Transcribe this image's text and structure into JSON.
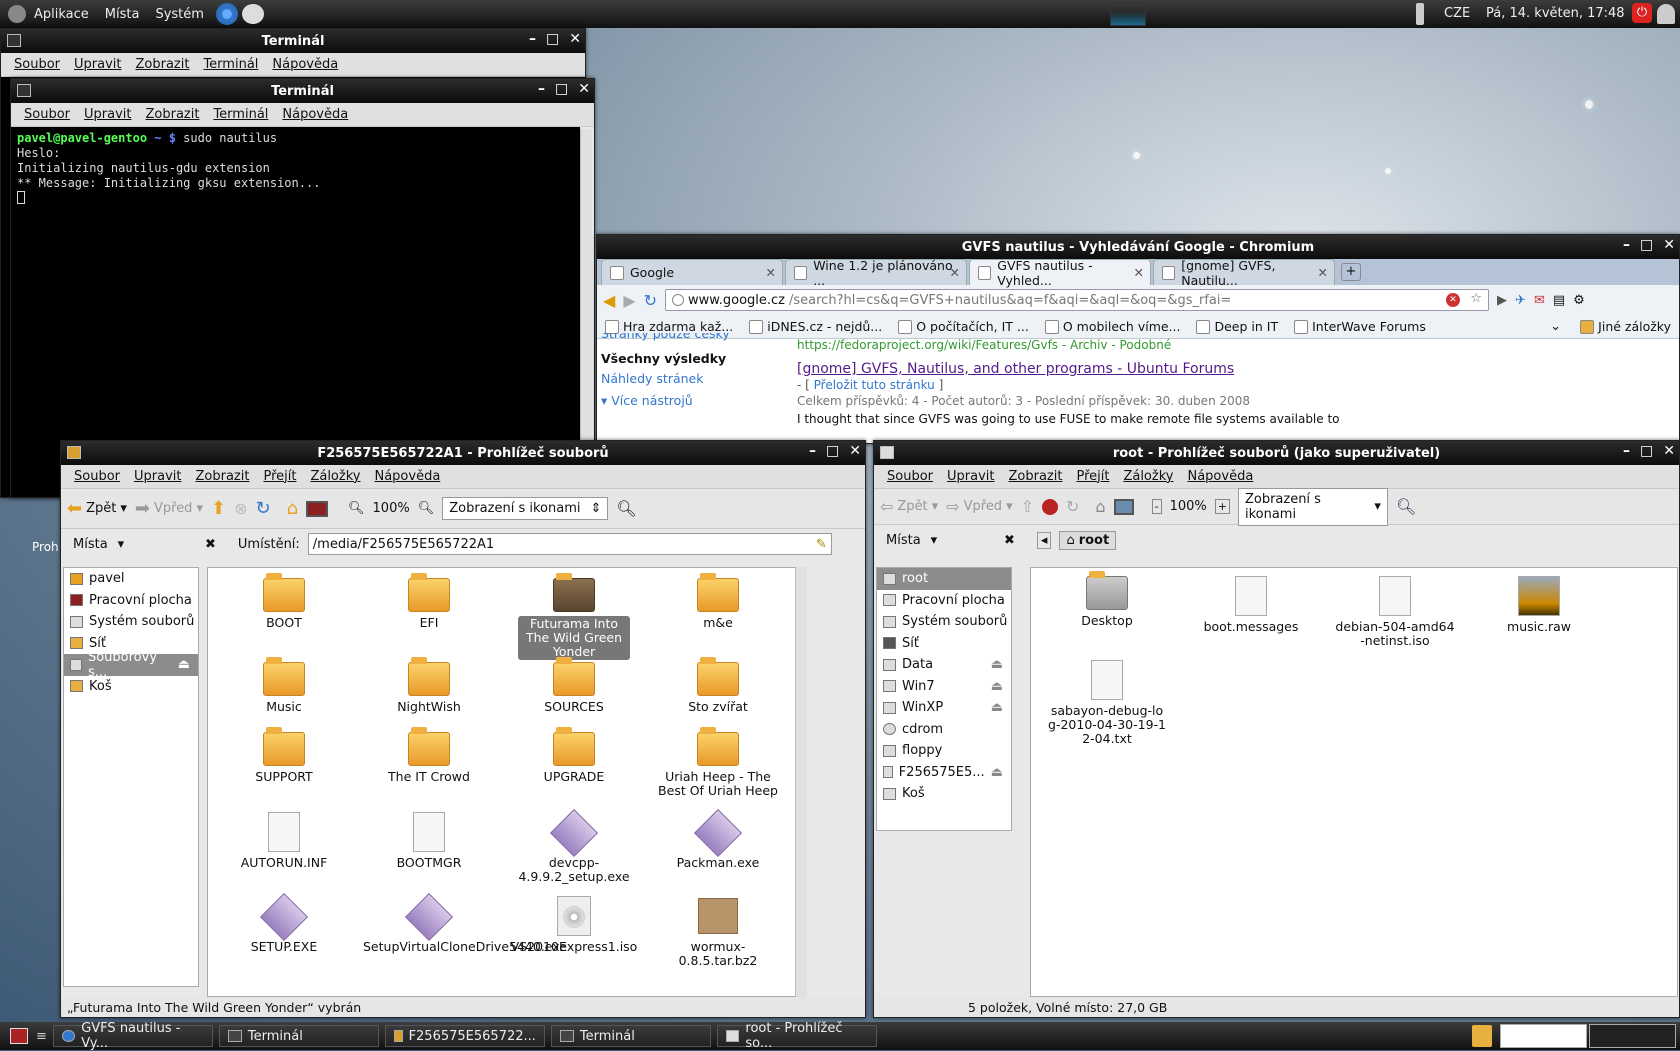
{
  "top_panel": {
    "menus": [
      "Aplikace",
      "Místa",
      "Systém"
    ],
    "keyboard": "CZE",
    "clock": "Pá, 14. květen, 17:48"
  },
  "term1": {
    "title": "Terminál",
    "menu": [
      "Soubor",
      "Upravit",
      "Zobrazit",
      "Terminál",
      "Nápověda"
    ]
  },
  "term2": {
    "title": "Terminál",
    "menu": [
      "Soubor",
      "Upravit",
      "Zobrazit",
      "Terminál",
      "Nápověda"
    ],
    "lines": {
      "prompt": "pavel@pavel-gentoo",
      "dir": " ~ $ ",
      "cmd": "sudo nautilus",
      "l2": "Heslo:",
      "l3": "Initializing nautilus-gdu extension",
      "l4": "** Message: Initializing gksu extension..."
    }
  },
  "chromium": {
    "title": "GVFS nautilus - Vyhledávání Google - Chromium",
    "tabs": [
      "Google",
      "Wine 1.2 je plánováno ...",
      "GVFS nautilus - Vyhled...",
      "[gnome] GVFS, Nautilu..."
    ],
    "url_host": "www.google.cz",
    "url_rest": "/search?hl=cs&q=GVFS+nautilus&aq=f&aqi=&aql=&oq=&gs_rfai=",
    "bookmarks": [
      "Hra zdarma kaž...",
      "iDNES.cz - nejdů...",
      "O počítačích, IT ...",
      "O mobilech víme...",
      "Deep in IT",
      "InterWave Forums"
    ],
    "other_bookmarks": "Jiné záložky",
    "side": {
      "cut": "Stránky pouze česky",
      "all": "Všechny výsledky",
      "previews": "Náhledy stránek",
      "more": "Více nástrojů"
    },
    "result": {
      "url_line": "https://fedoraproject.org/wiki/Features/Gvfs - Archiv - Podobné",
      "title": "[gnome] GVFS, Nautilus, and other programs - Ubuntu Forums",
      "translate": "Přeložit tuto stránku",
      "meta": "Celkem příspěvků: 4 - Počet autorů: 3 - Poslední příspěvek: 30. duben 2008",
      "snippet": "I thought that since GVFS was going to use FUSE to make remote file systems available to"
    }
  },
  "fm1": {
    "title": "F256575E565722A1 - Prohlížeč souborů",
    "menu": [
      "Soubor",
      "Upravit",
      "Zobrazit",
      "Přejít",
      "Záložky",
      "Nápověda"
    ],
    "back": "Zpět",
    "forward": "Vpřed",
    "zoom": "100%",
    "view": "Zobrazení s ikonami",
    "side_label": "Místa",
    "location_label": "Umístění:",
    "location": "/media/F256575E565722A1",
    "places": [
      "pavel",
      "Pracovní plocha",
      "Systém souborů",
      "Síť",
      "Souborový s...",
      "Koš"
    ],
    "items": [
      {
        "n": "BOOT",
        "t": "folder"
      },
      {
        "n": "EFI",
        "t": "folder"
      },
      {
        "n": "Futurama Into The Wild Green Yonder",
        "t": "dark"
      },
      {
        "n": "m&e",
        "t": "folder"
      },
      {
        "n": "Music",
        "t": "folder"
      },
      {
        "n": "NightWish",
        "t": "folder"
      },
      {
        "n": "SOURCES",
        "t": "folder"
      },
      {
        "n": "Sto zvířat",
        "t": "folder"
      },
      {
        "n": "SUPPORT",
        "t": "folder"
      },
      {
        "n": "The IT Crowd",
        "t": "folder"
      },
      {
        "n": "UPGRADE",
        "t": "folder"
      },
      {
        "n": "Uriah Heep - The Best Of Uriah Heep",
        "t": "folder"
      },
      {
        "n": "AUTORUN.INF",
        "t": "doc"
      },
      {
        "n": "BOOTMGR",
        "t": "doc"
      },
      {
        "n": "devcpp-4.9.9.2_setup.exe",
        "t": "exe"
      },
      {
        "n": "Packman.exe",
        "t": "exe"
      },
      {
        "n": "SETUP.EXE",
        "t": "exe"
      },
      {
        "n": "SetupVirtualCloneDrive5440.exe",
        "t": "exe"
      },
      {
        "n": "VS2010Express1.iso",
        "t": "iso"
      },
      {
        "n": "wormux-0.8.5.tar.bz2",
        "t": "pkg"
      }
    ],
    "status": "„Futurama Into The Wild Green Yonder“ vybrán"
  },
  "fm2": {
    "title": "root - Prohlížeč souborů (jako superuživatel)",
    "menu": [
      "Soubor",
      "Upravit",
      "Zobrazit",
      "Přejít",
      "Záložky",
      "Nápověda"
    ],
    "back": "Zpět",
    "forward": "Vpřed",
    "zoom": "100%",
    "view": "Zobrazení s ikonami",
    "side_label": "Místa",
    "crumb": "root",
    "places": [
      "root",
      "Pracovní plocha",
      "Systém souborů",
      "Síť",
      "Data",
      "Win7",
      "WinXP",
      "cdrom",
      "floppy",
      "F256575E5...",
      "Koš"
    ],
    "items": [
      {
        "n": "Desktop"
      },
      {
        "n": "boot.messages"
      },
      {
        "n": "debian-504-amd64-netinst.iso"
      },
      {
        "n": "music.raw"
      },
      {
        "n": "sabayon-debug-log-2010-04-30-19-12-04.txt"
      }
    ],
    "status": "5 položek, Volné místo: 27,0 GB"
  },
  "taskbar": [
    "GVFS nautilus - Vy...",
    "Terminál",
    "F256575E565722...",
    "Terminál",
    "root - Prohlížeč so..."
  ]
}
